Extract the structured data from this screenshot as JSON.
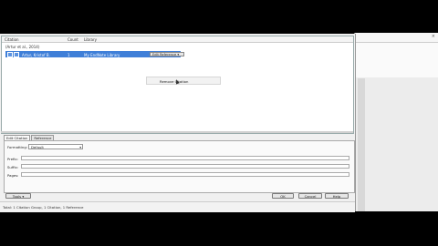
{
  "background_window": {
    "close_glyph": "×"
  },
  "list": {
    "columns": [
      "Citation",
      "Count",
      "Library"
    ],
    "group_row": "(Artur et al., 2014)",
    "citation": {
      "text": "Artur, Kristof B.",
      "count": "1",
      "library": "My EndNote Library"
    },
    "edit_reference_label": "Edit Reference ▾"
  },
  "context_menu": {
    "item": "Remove Citation"
  },
  "tabs": [
    {
      "label": "Edit Citation",
      "active": true
    },
    {
      "label": "Reference",
      "active": false
    }
  ],
  "edit_citation": {
    "formatting_label": "Formatting:",
    "formatting_value": "Default",
    "prefix_label": "Prefix:",
    "suffix_label": "Suffix:",
    "pages_label": "Pages:"
  },
  "buttons": {
    "tools": "Tools ▾",
    "ok": "OK",
    "cancel": "Cancel",
    "help": "Help"
  },
  "status": "Total: 1 Citation Group, 1 Citation, 1 Reference"
}
